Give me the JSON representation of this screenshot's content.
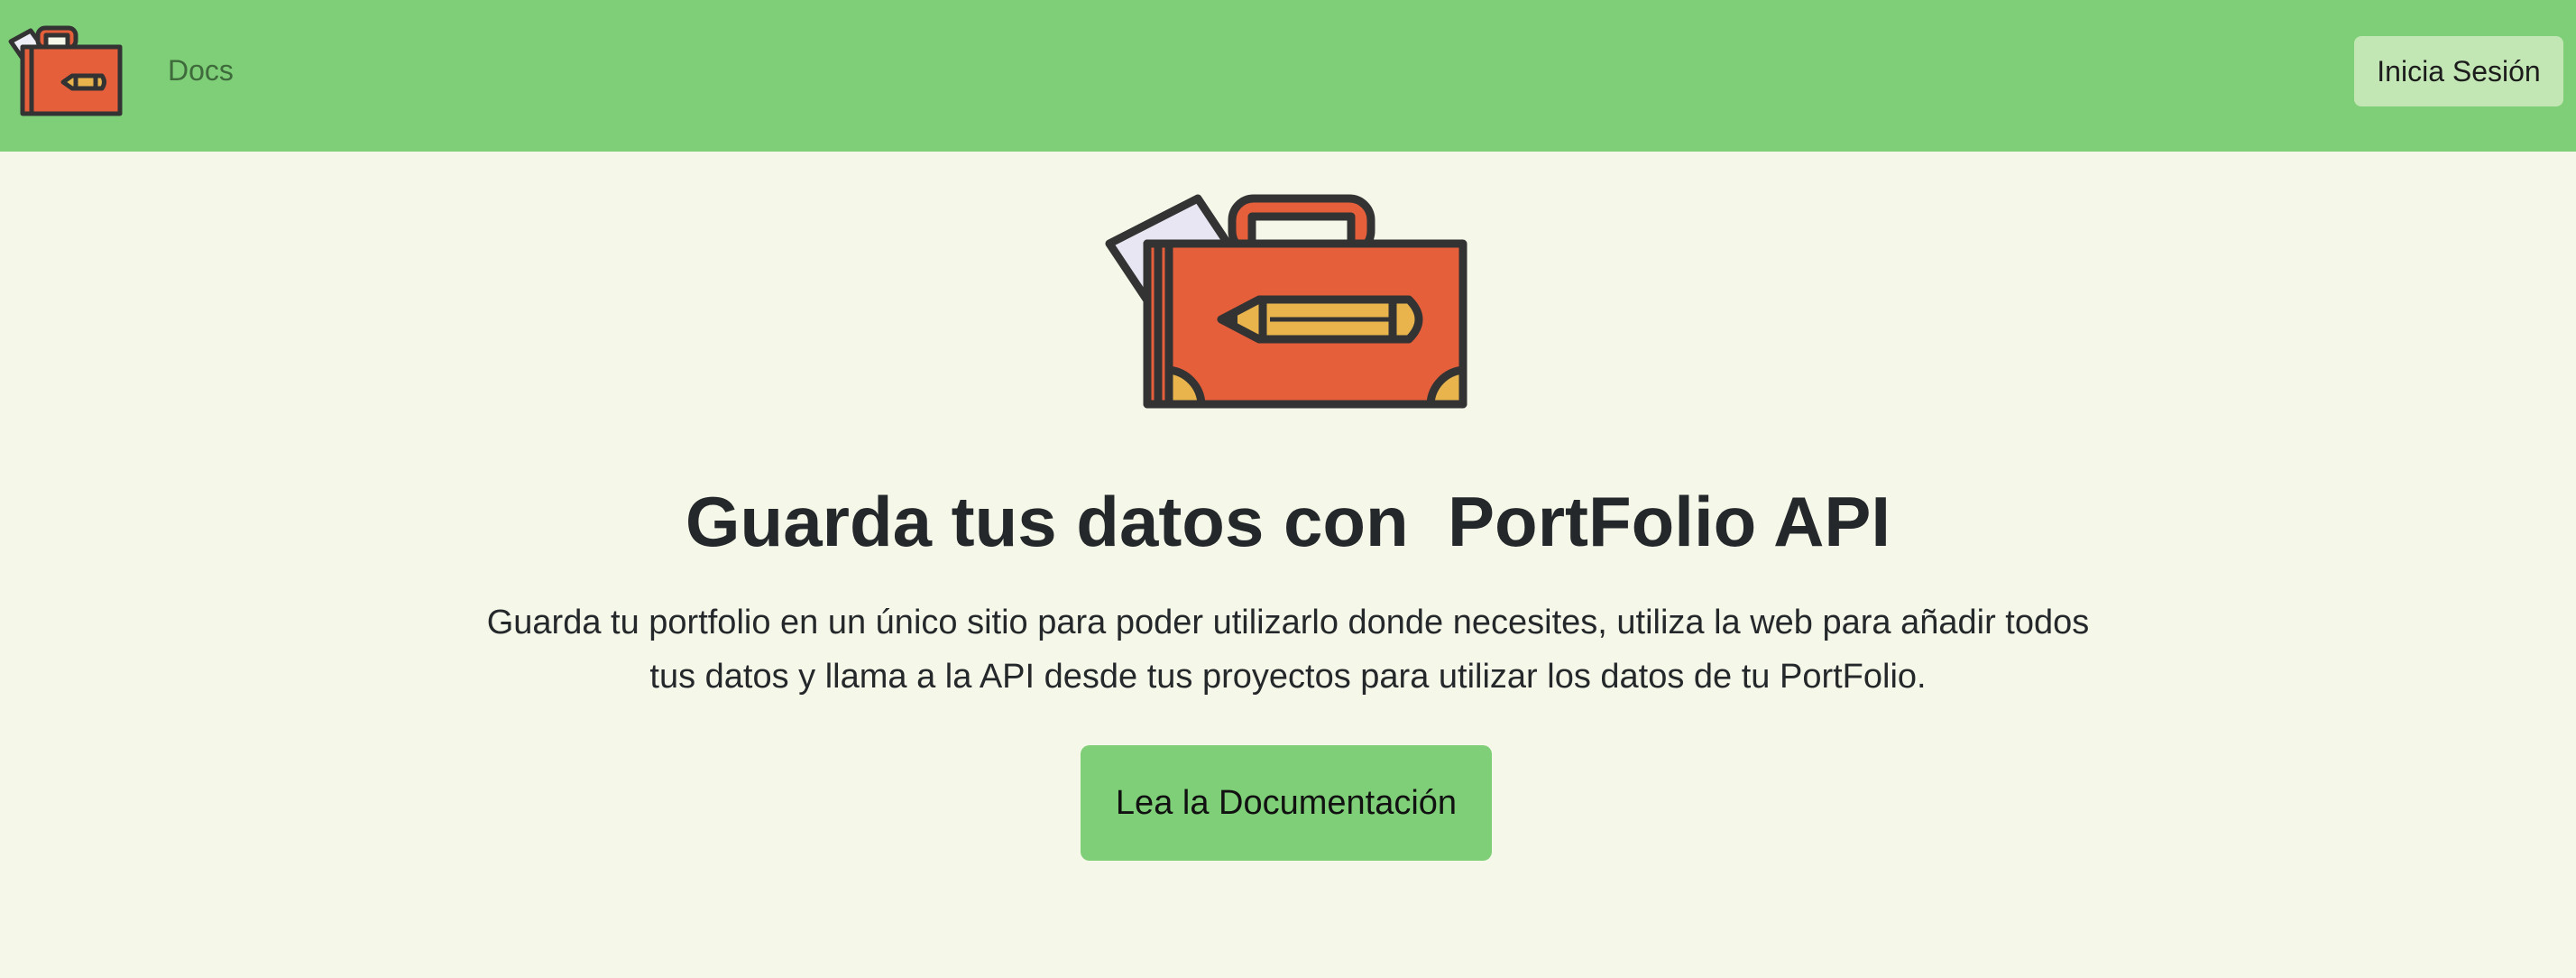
{
  "nav": {
    "logo_icon": "briefcase-pencil-icon",
    "docs_label": "Docs",
    "login_label": "Inicia Sesión"
  },
  "hero": {
    "logo_icon": "briefcase-pencil-icon",
    "title": "Guarda tus datos con  PortFolio API",
    "description": "Guarda tu portfolio en un único sitio para poder utilizarlo donde necesites, utiliza la web para añadir todos tus datos y llama a la API desde tus proyectos para utilizar los datos de tu PortFolio.",
    "cta_label": "Lea la Documentación"
  },
  "colors": {
    "navbar": "#7ecf77",
    "page_background": "#f5f8e8",
    "login_button": "#c2e7b4",
    "cta_button": "#7ecf77",
    "briefcase": "#e65f3b",
    "pencil": "#e9b44c",
    "outline": "#333333"
  }
}
